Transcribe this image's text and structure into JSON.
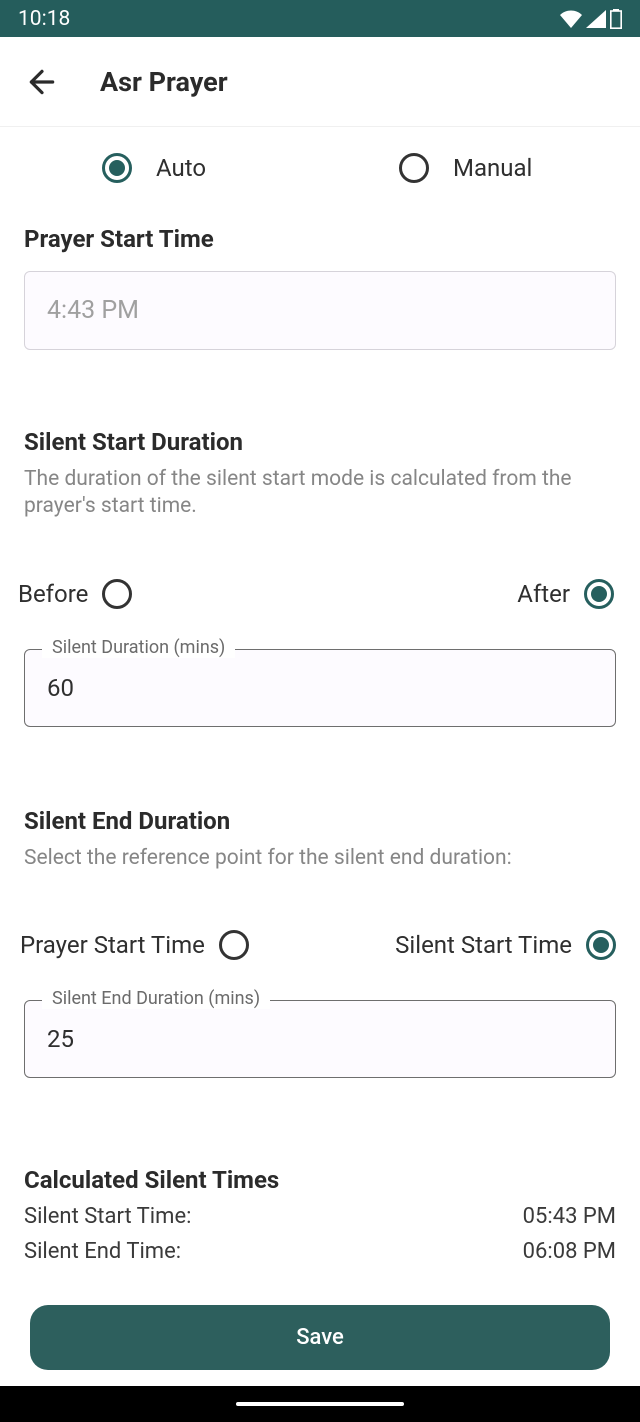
{
  "statusbar": {
    "time": "10:18"
  },
  "appbar": {
    "title": "Asr Prayer"
  },
  "mode": {
    "auto": "Auto",
    "manual": "Manual",
    "selected": "auto"
  },
  "prayerStart": {
    "title": "Prayer Start Time",
    "value": "4:43 PM"
  },
  "silentStart": {
    "title": "Silent Start Duration",
    "desc": "The duration of the silent start mode is calculated from the prayer's start time.",
    "before": "Before",
    "after": "After",
    "selected": "after",
    "fieldLabel": "Silent Duration (mins)",
    "value": "60"
  },
  "silentEnd": {
    "title": "Silent End Duration",
    "desc": "Select the reference point for the silent end duration:",
    "opt1": "Prayer Start Time",
    "opt2": "Silent Start Time",
    "selected": "opt2",
    "fieldLabel": "Silent End Duration (mins)",
    "value": "25"
  },
  "calc": {
    "title": "Calculated Silent Times",
    "row1Label": "Silent Start Time:",
    "row1Value": "05:43 PM",
    "row2Label": "Silent End Time:",
    "row2Value": "06:08 PM"
  },
  "save": "Save"
}
